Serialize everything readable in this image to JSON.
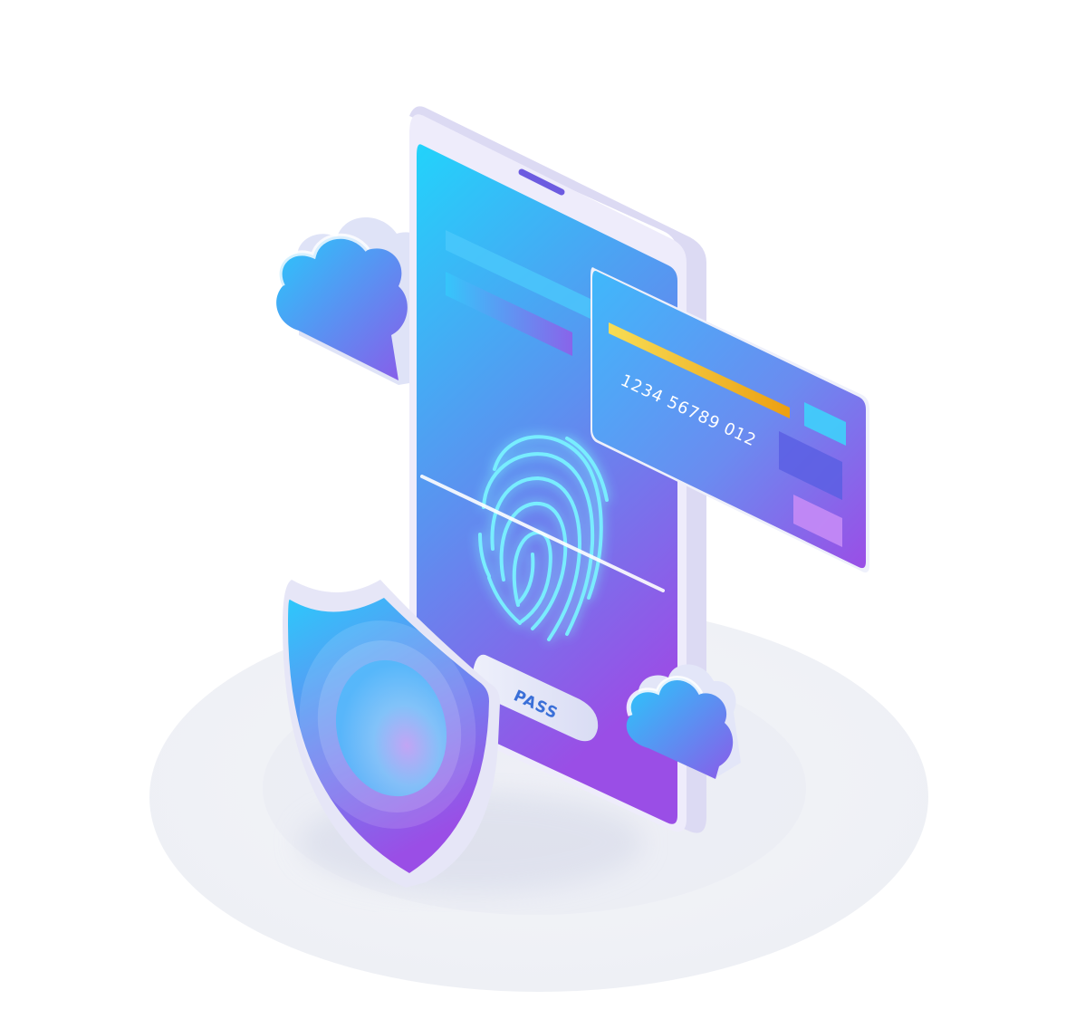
{
  "illustration": {
    "subject": "mobile-biometric-payment-security",
    "icons": [
      "smartphone-icon",
      "fingerprint-icon",
      "credit-card-icon",
      "shield-icon",
      "cloud-icon",
      "cloud-icon"
    ]
  },
  "card": {
    "number": "1234 56789 012"
  },
  "phone": {
    "pass_button_label": "PASS"
  },
  "colors": {
    "background": "#ffffff",
    "platform": "#f1f2f6",
    "device_frame": "#e8e6f8",
    "gradient_cyan": "#22d3fb",
    "gradient_blue": "#5a93f0",
    "gradient_purple": "#9a4ee6",
    "card_stripe": "#f4c01c",
    "fingerprint_glow": "#7af3ff",
    "pass_text": "#3a6fd8"
  }
}
